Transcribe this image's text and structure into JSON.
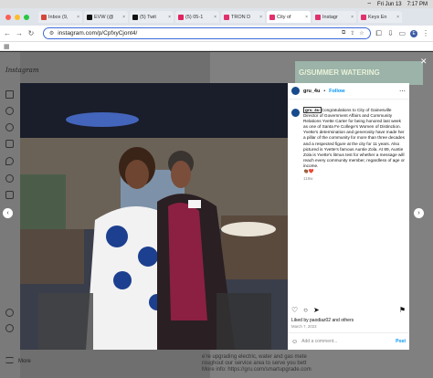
{
  "menubar": {
    "date": "Fri Jun 13",
    "time": "7:17 PM"
  },
  "tabs": [
    {
      "label": "Inbox (9,",
      "color": "#d44638"
    },
    {
      "label": "EVW (@",
      "color": "#111111"
    },
    {
      "label": "(5) Twit",
      "color": "#111111"
    },
    {
      "label": "(5) 05-1",
      "color": "#e0245e"
    },
    {
      "label": "TRON D",
      "color": "#e1306c"
    },
    {
      "label": "City of",
      "color": "#e1306c",
      "active": true
    },
    {
      "label": "Instagr",
      "color": "#e1306c"
    },
    {
      "label": "Keys En",
      "color": "#e1306c"
    }
  ],
  "address": {
    "url": "instagram.com/p/CpfxyCjont4/"
  },
  "instagram": {
    "logo": "Instagram",
    "more_label": "More"
  },
  "post": {
    "username": "gru_4u",
    "follow_label": "Follow",
    "caption_user": "gru_4u",
    "caption": "Congratulations to City of Gainesville Director of Government Affairs and Community Relations Yvette Carter for being honored last week as one of Santa Fe College's Women of Distinction. Yvette's determination and generosity have made her a pillar of the community for more than three decades and a respected figure at the city for 11 years. Also pictured is Yvette's famous Auntie Zola. At 89, Auntie Zola is Yvette's litmus test for whether a message will reach every community member, regardless of age or income.",
    "emoji": "👏🏾❤️",
    "ago": "118w",
    "liked_by": "Liked by paodiaz02 and others",
    "date": "March 7, 2023",
    "comment_placeholder": "Add a comment...",
    "post_label": "Post"
  },
  "background": {
    "banner": "G/SUMMER WATERING",
    "text_lines": [
      "e're upgrading electric, water and gas mete",
      "roughout our service area to serve you bett",
      "More info: https://gru.com/smartupgrade.com"
    ]
  }
}
